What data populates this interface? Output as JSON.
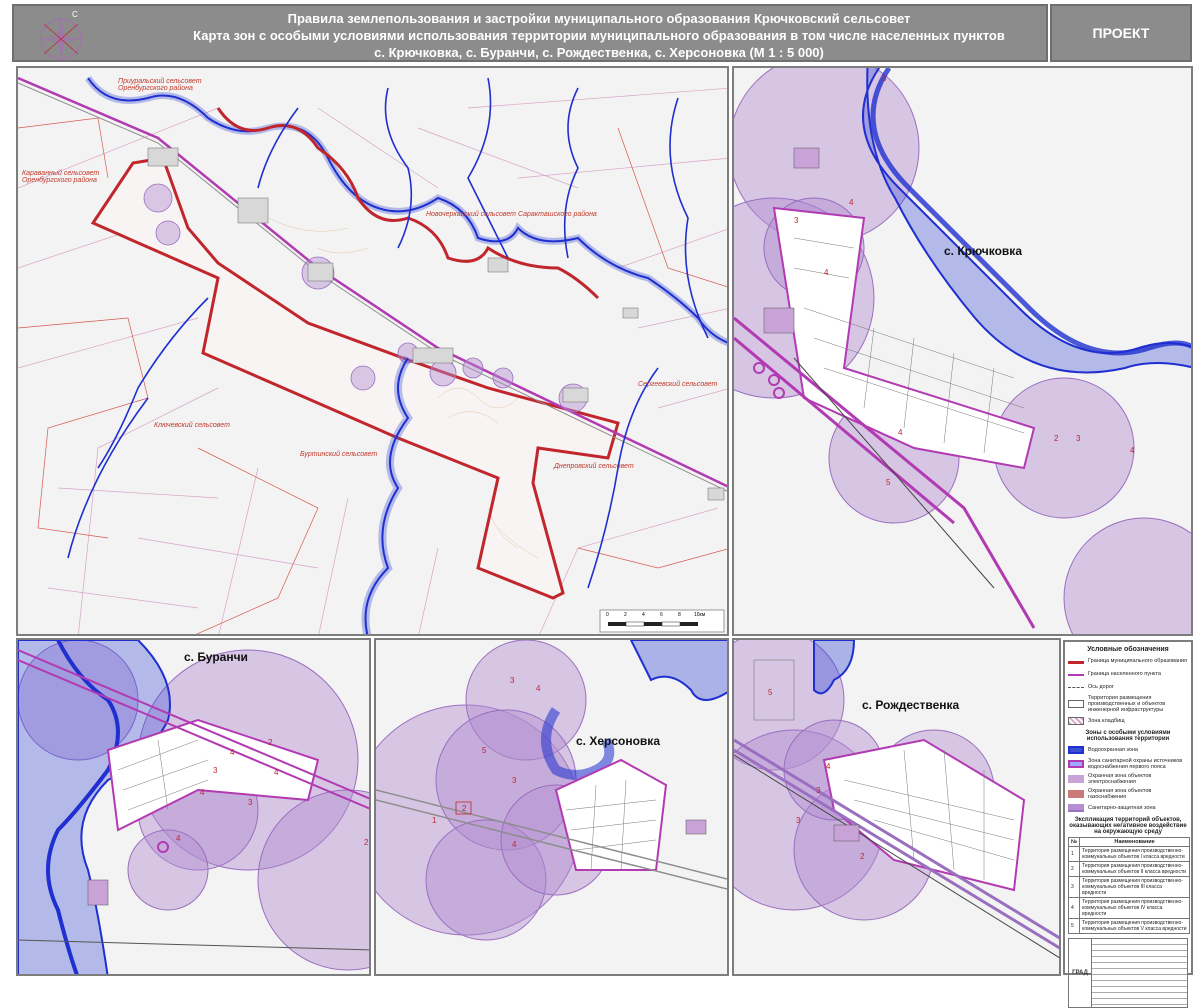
{
  "title": {
    "line1": "Правила землепользования и застройки муниципального образования Крючковский сельсовет",
    "line2": "Карта зон с особыми условиями использования территории муниципального образования в том числе населенных пунктов",
    "line3": "с.  Крючковка, с. Буранчи, с. Рождественка, с. Херсоновка (М 1 : 5 000)"
  },
  "stamp_label": "ПРОЕКТ",
  "compass_letter": "С",
  "main_map": {
    "labels": [
      "Приуральский сельсовет Оренбургского района",
      "Караванный сельсовет Оренбургского района",
      "Новочеркасский сельсовет Саракташского района",
      "Ключевский сельсовет",
      "Буртинский сельсовет",
      "Днепровский сельсовет",
      "Сергеевский сельсовет"
    ],
    "scale_ticks": [
      "0",
      "2",
      "4",
      "6",
      "8",
      "10км"
    ]
  },
  "insets": {
    "kryuchkovka": {
      "name": "с. Крючковка",
      "zones": [
        "3",
        "4",
        "3",
        "4",
        "5",
        "4",
        "2",
        "3",
        "4"
      ]
    },
    "buranchi": {
      "name": "с. Буранчи",
      "zones": [
        "2",
        "4",
        "3",
        "4",
        "4",
        "3",
        "4",
        "2"
      ]
    },
    "khersonovka": {
      "name": "с. Херсоновка",
      "zones": [
        "3",
        "4",
        "5",
        "3",
        "2",
        "1",
        "4"
      ]
    },
    "rozhdestvenka": {
      "name": "с. Рождественка",
      "zones": [
        "5",
        "4",
        "3",
        "3",
        "2"
      ]
    }
  },
  "legend": {
    "title": "Условные обозначения",
    "items": [
      {
        "label": "Граница муниципального образования",
        "color": "#c0262c"
      },
      {
        "label": "Граница населенного пункта",
        "color": "#b23ab2"
      },
      {
        "label": "Ось дорог",
        "color": "#555555"
      },
      {
        "label": "Территория размещения производственных и объектов инженерной инфраструктуры",
        "color": "#ffffff"
      },
      {
        "label": "Зона кладбищ",
        "color": "#d9a5c9"
      }
    ],
    "zones_title": "Зоны с особыми условиями использования территории",
    "zone_items": [
      {
        "label": "Водоохранная зона",
        "color": "#3b4fd6"
      },
      {
        "label": "Зона санитарной охраны источников водоснабжения первого пояса",
        "color": "#a0a8ff"
      },
      {
        "label": "Охранная зона объектов электроснабжения",
        "color": "#c9a3d8"
      },
      {
        "label": "Охранная зона объектов газоснабжения",
        "color": "#c97b7b"
      },
      {
        "label": "Санитарно-защитная зона",
        "color": "#b48fd1"
      }
    ],
    "table_title": "Экспликация территорий объектов, оказывающих негативное воздействие на окружающую среду",
    "table_headers": [
      "№",
      "Наименование"
    ],
    "table_rows": [
      {
        "num": "1",
        "name": "Территория размещения производственно-коммунальных объектов I класса вредности"
      },
      {
        "num": "2",
        "name": "Территория размещения производственно-коммунальных объектов II класса вредности"
      },
      {
        "num": "3",
        "name": "Территория размещения производственно-коммунальных объектов III класса вредности"
      },
      {
        "num": "4",
        "name": "Территория размещения производственно-коммунальных объектов IV класса вредности"
      },
      {
        "num": "5",
        "name": "Территория размещения производственно-коммунальных объектов V класса вредности"
      }
    ],
    "stamp_logo": "ГРАД"
  },
  "colors": {
    "boundary_red": "#c0262c",
    "river_blue": "#1f2fd0",
    "water_fill": "#8a95e8",
    "zone_purple": "#b48fd1",
    "settlement_magenta": "#b23ab2",
    "panel_bg": "#f3f3f3"
  }
}
